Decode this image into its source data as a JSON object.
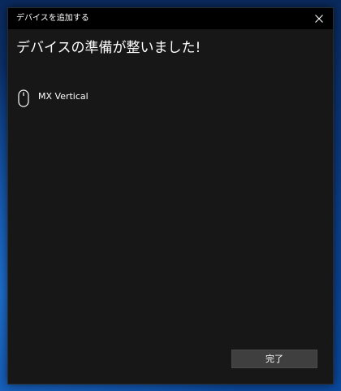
{
  "window": {
    "title": "デバイスを追加する",
    "close_icon": "close-icon"
  },
  "main": {
    "heading": "デバイスの準備が整いました!",
    "device": {
      "icon": "mouse-icon",
      "name": "MX Vertical"
    }
  },
  "footer": {
    "done_label": "完了"
  },
  "colors": {
    "window_bg": "#171717",
    "titlebar_bg": "#000000",
    "button_bg": "#3f3f3f",
    "text": "#ffffff"
  }
}
